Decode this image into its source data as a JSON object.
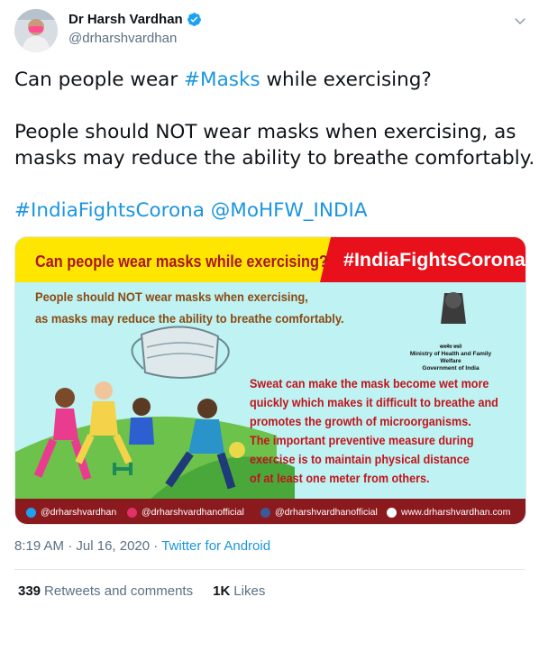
{
  "author": {
    "display_name": "Dr Harsh Vardhan",
    "handle": "@drharshvardhan",
    "verified": true
  },
  "tweet": {
    "line1_prefix": "Can people wear ",
    "line1_hashtag": "#Masks",
    "line1_suffix": " while exercising?",
    "para2_line1": "People should NOT wear masks when exercising, as",
    "para2_line2": "masks may reduce the ability to breathe comfortably.",
    "tag1": "#IndiaFightsCorona",
    "tag2": "@MoHFW_INDIA"
  },
  "image": {
    "question": "Can people wear masks while exercising?",
    "hashtag": "#IndiaFightsCorona",
    "advice_line1": "People should NOT wear masks when exercising,",
    "advice_line2": "as masks may reduce the ability to breathe comfortably.",
    "ministry_hindi": "सत्यमेव जयते",
    "ministry_line1": "Ministry of Health and Family Welfare",
    "ministry_line2": "Government of India",
    "sweat_lines": [
      "Sweat can make the mask become wet more",
      "quickly which makes it difficult to breathe and",
      "promotes the growth of microorganisms.",
      "The important preventive measure during",
      "exercise is to maintain physical distance",
      "of at least one meter from others."
    ],
    "social": {
      "twitter": "@drharshvardhan",
      "instagram": "@drharshvardhanofficial",
      "facebook": "@drharshvardhanofficial",
      "web": "www.drharshvardhan.com"
    }
  },
  "meta": {
    "time": "8:19 AM",
    "date": "Jul 16, 2020",
    "source": "Twitter for Android",
    "separator": " · "
  },
  "stats": {
    "retweets_count": "339",
    "retweets_label": "Retweets and comments",
    "likes_count": "1K",
    "likes_label": "Likes"
  },
  "colors": {
    "link": "#1b95e0",
    "verified": "#1da1f2",
    "banner_yellow": "#ffe600",
    "banner_red": "#e8101b",
    "card_bg": "#bff2f2",
    "footer": "#8b1a1f"
  }
}
